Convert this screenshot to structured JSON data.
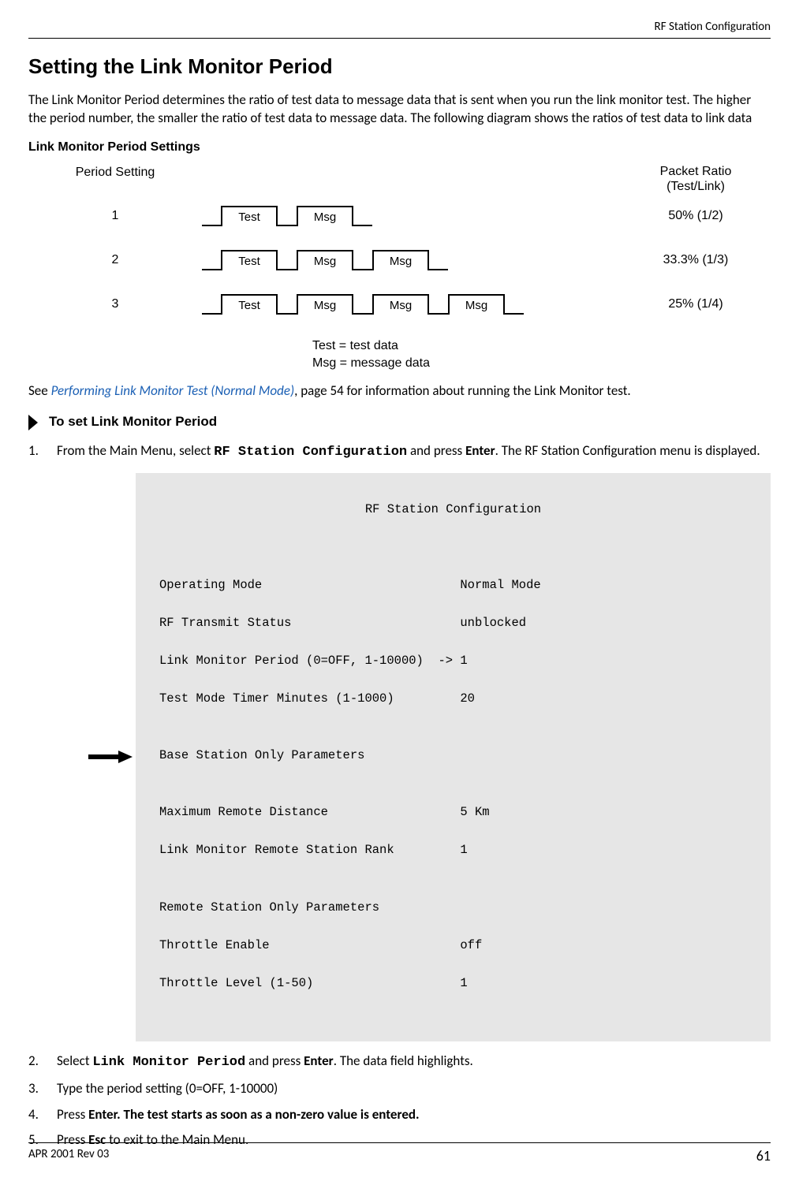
{
  "header": {
    "title": "RF Station Configuration"
  },
  "section": {
    "title": "Setting the Link Monitor Period",
    "intro": "The Link Monitor Period determines the ratio of test data to message data that is sent when you run the link monitor test. The higher the period number, the smaller the ratio of test data to message data. The following diagram shows the ratios of test data to link data"
  },
  "diagram": {
    "subheading": "Link Monitor Period Settings",
    "left_header": "Period Setting",
    "right_header": "Packet Ratio\n(Test/Link)",
    "rows": [
      {
        "period": "1",
        "boxes": [
          "Test",
          "Msg"
        ],
        "ratio": "50% (1/2)"
      },
      {
        "period": "2",
        "boxes": [
          "Test",
          "Msg",
          "Msg"
        ],
        "ratio": "33.3% (1/3)"
      },
      {
        "period": "3",
        "boxes": [
          "Test",
          "Msg",
          "Msg",
          "Msg"
        ],
        "ratio": "25% (1/4)"
      }
    ],
    "legend1": "Test = test data",
    "legend2": "Msg = message data"
  },
  "see": {
    "pre": "See ",
    "link": "Performing Link Monitor Test (Normal Mode)",
    "post": ", page 54 for information about running the Link Monitor test."
  },
  "procedure": {
    "title": "To set Link Monitor Period",
    "step1_pre": "From the Main Menu, select ",
    "step1_code": "RF Station Configuration",
    "step1_mid": " and press ",
    "step1_key": "Enter",
    "step1_post": ". The RF Station Configuration menu is displayed.",
    "step2_pre": "Select ",
    "step2_code": "Link Monitor Period",
    "step2_mid": " and press ",
    "step2_key": "Enter",
    "step2_post": ". The data field highlights.",
    "step3": "Type the period setting (0=OFF, 1-10000)",
    "step4_pre": "Press ",
    "step4_key": "Enter",
    "step4_bold": ". The test starts as soon as a non-zero value is entered.",
    "step5_pre": "Press ",
    "step5_key": "Esc",
    "step5_post": " to exit to the Main Menu."
  },
  "terminal": {
    "title": "RF Station Configuration",
    "lines": [
      "Operating Mode                           Normal Mode",
      "RF Transmit Status                       unblocked",
      "Link Monitor Period (0=OFF, 1-10000)  -> 1",
      "Test Mode Timer Minutes (1-1000)         20",
      "",
      "Base Station Only Parameters",
      "",
      "Maximum Remote Distance                  5 Km",
      "Link Monitor Remote Station Rank         1",
      "",
      "Remote Station Only Parameters",
      "Throttle Enable                          off",
      "Throttle Level (1-50)                    1"
    ]
  },
  "footer": {
    "left": "APR 2001 Rev 03",
    "page": "61"
  }
}
